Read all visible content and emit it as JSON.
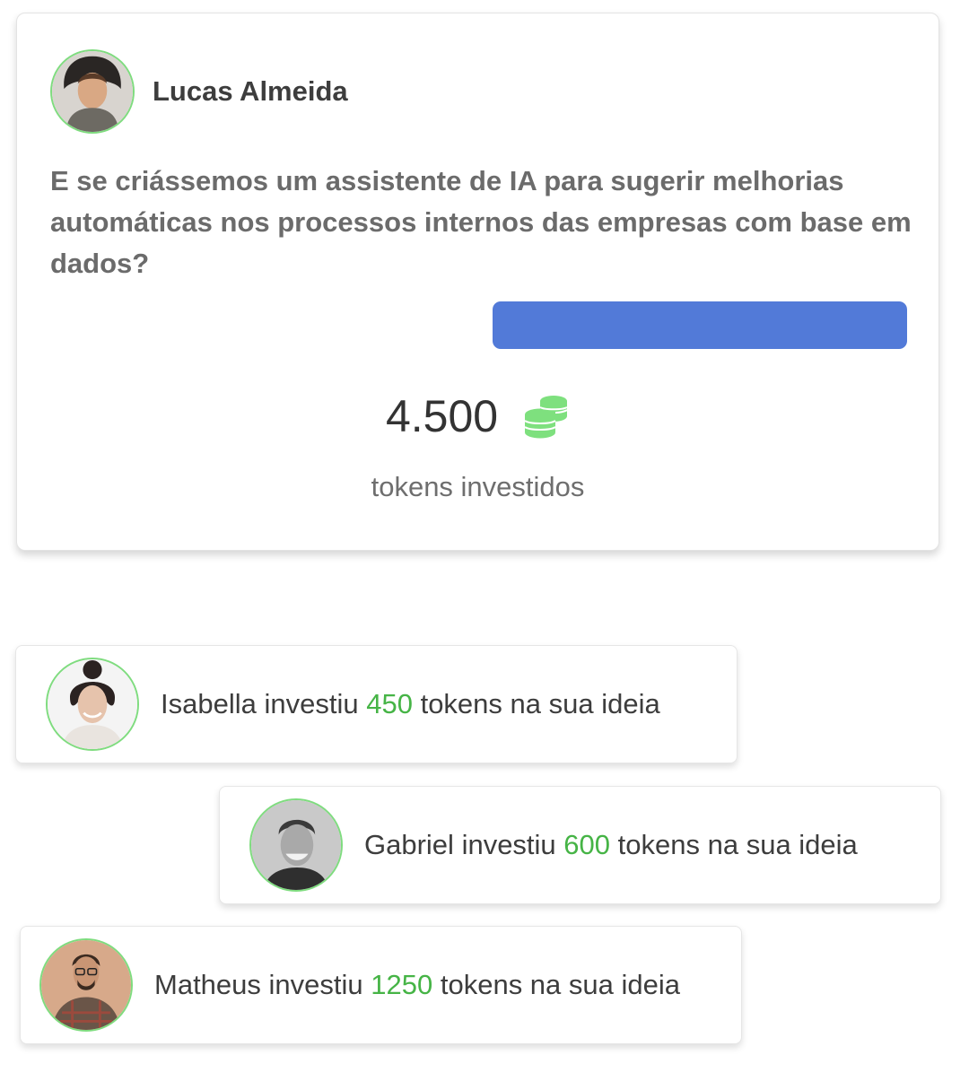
{
  "idea": {
    "author": "Lucas Almeida",
    "text": "E se criássemos um assistente de IA para sugerir melhorias automáticas nos processos internos das empresas com base em dados?",
    "total_tokens": "4.500",
    "total_label": "tokens investidos",
    "coins_icon": "coins-icon"
  },
  "notifications": [
    {
      "name": "Isabella",
      "verb": "investiu",
      "amount": "450",
      "suffix": "tokens na sua ideia"
    },
    {
      "name": "Gabriel",
      "verb": "investiu",
      "amount": "600",
      "suffix": "tokens na sua ideia"
    },
    {
      "name": "Matheus",
      "verb": "investiu",
      "amount": "1250",
      "suffix": "tokens na sua ideia"
    }
  ],
  "colors": {
    "accent_button": "#527ad8",
    "token_green": "#46b446",
    "coin_green": "#7ee07e",
    "avatar_border": "#7fdc7f"
  }
}
